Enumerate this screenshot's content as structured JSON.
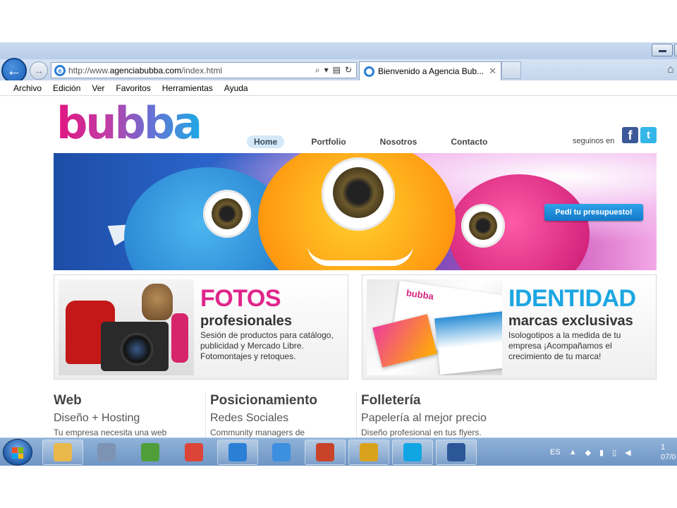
{
  "browser": {
    "url_prefix": "http://www.",
    "url_domain": "agenciabubba.com",
    "url_path": "/index.html",
    "tab_title": "Bienvenido a Agencia Bub...",
    "tab_close": "✕",
    "back_glyph": "←",
    "forward_glyph": "→",
    "search_glyph": "⌕",
    "dropdown_glyph": "▾",
    "compat_glyph": "▤",
    "refresh_glyph": "↻",
    "home_glyph": "⌂",
    "menu": [
      "Archivo",
      "Edición",
      "Ver",
      "Favoritos",
      "Herramientas",
      "Ayuda"
    ]
  },
  "site": {
    "logo": "bubba",
    "nav": [
      {
        "label": "Home",
        "active": true
      },
      {
        "label": "Portfolio",
        "active": false
      },
      {
        "label": "Nosotros",
        "active": false
      },
      {
        "label": "Contacto",
        "active": false
      }
    ],
    "seguinos": "seguinos en",
    "facebook_glyph": "f",
    "twitter_glyph": "t",
    "banner_button": "Pedí tu presupuesto!",
    "card_logo": "bubba",
    "promos": {
      "fotos": {
        "title": "FOTOS",
        "subtitle": "profesionales",
        "desc": "Sesión de productos para catálogo, publicidad y Mercado Libre. Fotomontajes y retoques."
      },
      "identidad": {
        "title": "IDENTIDAD",
        "subtitle": "marcas exclusivas",
        "desc": "Isologotipos a la medida de tu empresa ¡Acompañamos el crecimiento de tu marca!"
      }
    },
    "services": [
      {
        "title": "Web",
        "subtitle": "Diseño + Hosting",
        "desc": "Tu empresa necesita una web"
      },
      {
        "title": "Posicionamiento",
        "subtitle": "Redes Sociales",
        "desc": "Community managers de"
      },
      {
        "title": "Folletería",
        "subtitle": "Papelería al mejor precio",
        "desc": "Diseño profesional en tus flyers."
      }
    ]
  },
  "taskbar": {
    "language": "ES",
    "tray_up_glyph": "▲",
    "clock_line1": "1",
    "clock_line2": "07/0",
    "apps": [
      {
        "icon": "folder-icon",
        "color": "#e8b84a"
      },
      {
        "icon": "calculator-icon",
        "color": "#7c93b3"
      },
      {
        "icon": "users-icon",
        "color": "#4f9e3a"
      },
      {
        "icon": "chrome-icon",
        "color": "#db4437"
      },
      {
        "icon": "internet-explorer-icon",
        "color": "#2b7fd4"
      },
      {
        "icon": "dropbox-icon",
        "color": "#3d8fe0"
      },
      {
        "icon": "presentation-icon",
        "color": "#c8432a"
      },
      {
        "icon": "mail-icon",
        "color": "#d9a21c"
      },
      {
        "icon": "skype-icon",
        "color": "#12a5e3"
      },
      {
        "icon": "word-icon",
        "color": "#2b5797"
      }
    ],
    "windows_flag_colors": [
      "#f25022",
      "#7fba00",
      "#00a4ef",
      "#ffb900"
    ]
  }
}
